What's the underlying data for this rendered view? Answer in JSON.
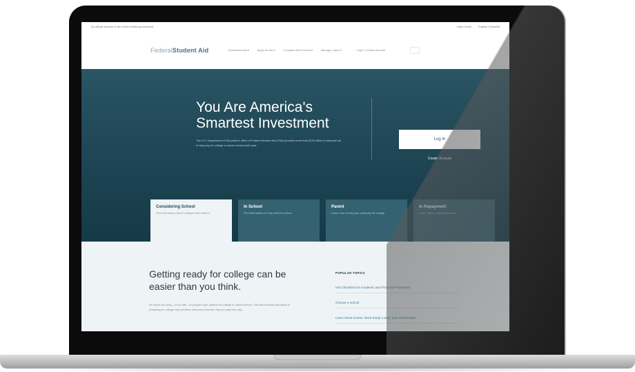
{
  "utility": {
    "left_text": "An official website of the United States government",
    "right_items": [
      "Help Center",
      "English | Español"
    ]
  },
  "nav": {
    "logo_prefix": "Federal",
    "logo_main": "Student Aid",
    "items": [
      "Understand Aid",
      "Apply for Aid",
      "Complete Aid Process",
      "Manage Loans"
    ],
    "login_link": "Log In | Create Account"
  },
  "hero": {
    "title": "You Are America's Smartest Investment",
    "text": "The U.S. Department of Education's office of Federal Student Aid (FSA) provides more than $120 billion in financial aid to help pay for college or career school each year.",
    "login_button": "Log In",
    "create_account": "Create Account"
  },
  "tabs": [
    {
      "title": "Considering School",
      "desc": "Find information about colleges and careers."
    },
    {
      "title": "In School",
      "desc": "Find information to help with the school."
    },
    {
      "title": "Parent",
      "desc": "Learn how to help your child pay for college."
    },
    {
      "title": "In Repayment",
      "desc": "Learn how to repay your loans."
    }
  ],
  "lower": {
    "title": "Getting ready for college can be easier than you think.",
    "text": "It's never too early—or too late—to prepare your options for college or career school. This site includes key steps in preparing for college and provides resources that can help you plan the way.",
    "popular_heading": "POPULAR TOPICS",
    "popular_links": [
      "Get Checklists for Academic and Financial Preparation",
      "Choose a School",
      "Learn About Grants, Work-Study, Loans, and Scholarships"
    ]
  },
  "colors": {
    "hero_top": "#2b5564",
    "hero_bottom": "#153a47",
    "tab_bg": "#3b6978",
    "link": "#3c7a96"
  }
}
